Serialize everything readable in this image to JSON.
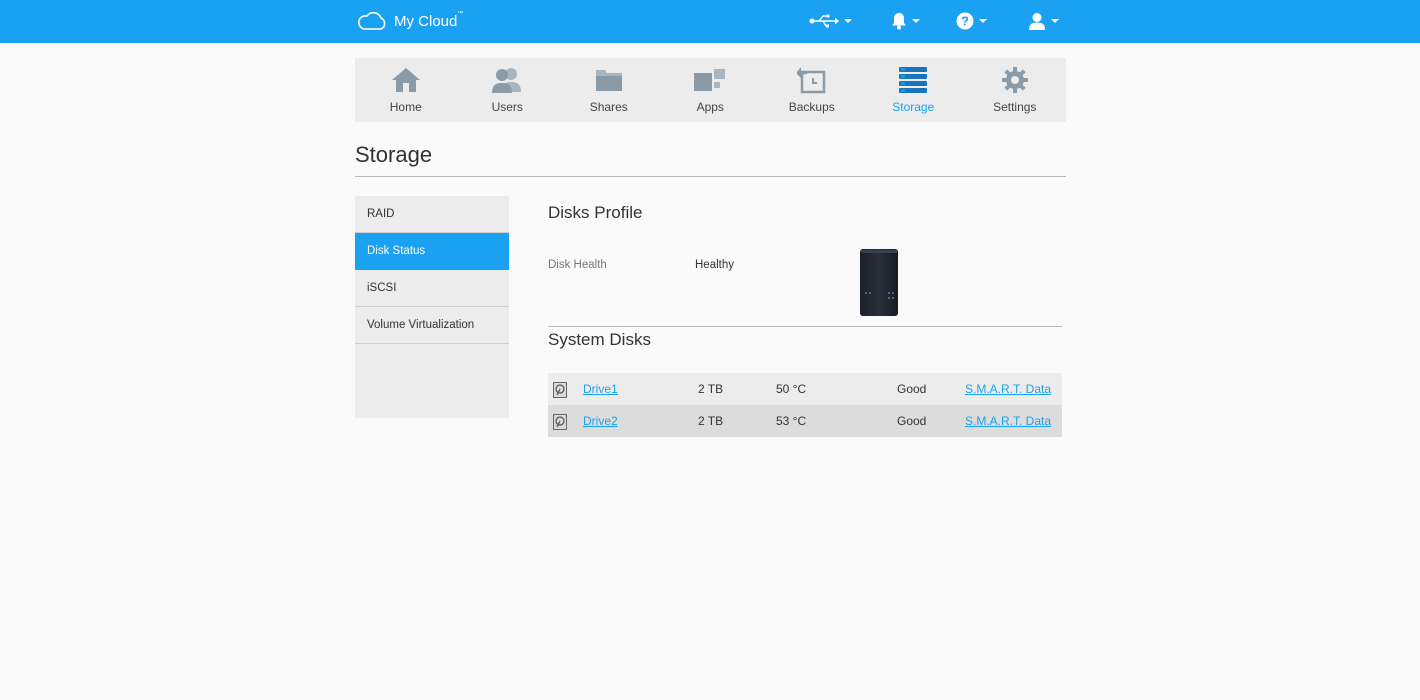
{
  "header": {
    "logo_text": "My Cloud",
    "logo_tm": "™",
    "icons": [
      "usb-icon",
      "bell-icon",
      "help-icon",
      "user-icon"
    ]
  },
  "nav": {
    "items": [
      {
        "label": "Home",
        "icon": "home-icon"
      },
      {
        "label": "Users",
        "icon": "users-icon"
      },
      {
        "label": "Shares",
        "icon": "folder-icon"
      },
      {
        "label": "Apps",
        "icon": "apps-icon"
      },
      {
        "label": "Backups",
        "icon": "backup-icon"
      },
      {
        "label": "Storage",
        "icon": "storage-icon",
        "active": true
      },
      {
        "label": "Settings",
        "icon": "gear-icon"
      }
    ],
    "active_color": "#1ba1f2"
  },
  "page": {
    "title": "Storage"
  },
  "sidebar": {
    "items": [
      {
        "label": "RAID"
      },
      {
        "label": "Disk Status",
        "active": true
      },
      {
        "label": "iSCSI"
      },
      {
        "label": "Volume Virtualization"
      }
    ]
  },
  "content": {
    "profile_title": "Disks Profile",
    "disk_health_label": "Disk Health",
    "disk_health_value": "Healthy",
    "system_disks_title": "System Disks",
    "disks": [
      {
        "name": "Drive1",
        "size": "2 TB",
        "temp": "50 °C",
        "status": "Good",
        "smart": "S.M.A.R.T. Data"
      },
      {
        "name": "Drive2",
        "size": "2 TB",
        "temp": "53 °C",
        "status": "Good",
        "smart": "S.M.A.R.T. Data"
      }
    ]
  },
  "colors": {
    "brand": "#1ba1f2",
    "nav_bg": "#ececec"
  }
}
